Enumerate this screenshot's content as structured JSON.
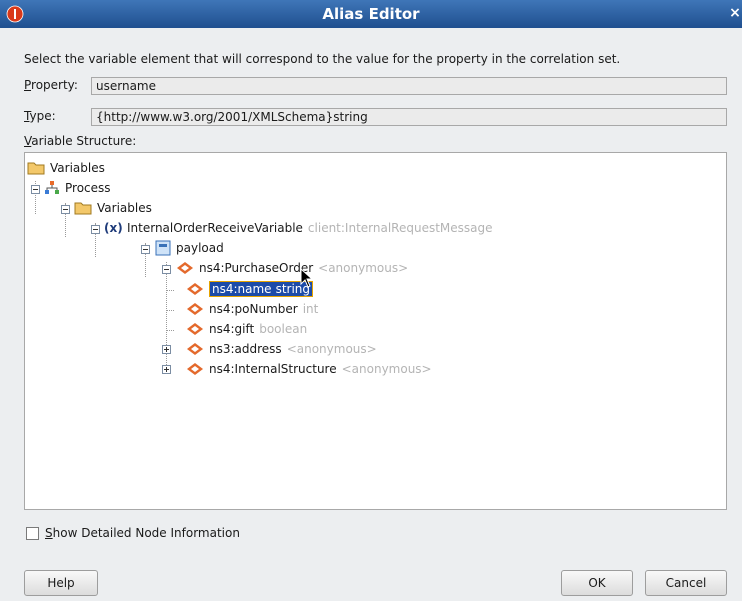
{
  "window": {
    "title": "Alias Editor",
    "close_glyph": "×"
  },
  "instruction": "Select the variable element that will correspond to the value for the property in the correlation set.",
  "property": {
    "label_underlined": "P",
    "label_rest": "roperty:",
    "value": "username"
  },
  "type_field": {
    "label_underlined": "T",
    "label_rest": "ype:",
    "value": "{http://www.w3.org/2001/XMLSchema}string"
  },
  "variable_structure": {
    "label_underlined": "V",
    "label_rest": "ariable Structure:"
  },
  "tree": {
    "variables_root": "Variables",
    "process": "Process",
    "process_variables": "Variables",
    "variable": {
      "name": "InternalOrderReceiveVariable",
      "type": "client:InternalRequestMessage"
    },
    "payload": "payload",
    "purchase_order": {
      "name": "ns4:PurchaseOrder",
      "type": "<anonymous>"
    },
    "children": [
      {
        "name": "ns4:name",
        "type": "string",
        "selected": true
      },
      {
        "name": "ns4:poNumber",
        "type": "int"
      },
      {
        "name": "ns4:gift",
        "type": "boolean"
      },
      {
        "name": "ns3:address",
        "type": "<anonymous>",
        "expandable": true
      },
      {
        "name": "ns4:InternalStructure",
        "type": "<anonymous>",
        "expandable": true
      }
    ]
  },
  "show_detailed": {
    "label_underlined": "S",
    "label_rest": "how Detailed Node Information",
    "checked": false
  },
  "buttons": {
    "help": "Help",
    "ok": "OK",
    "cancel": "Cancel"
  },
  "colors": {
    "title_bar": "#2d5fa3",
    "selection": "#1c4ba8",
    "type_text": "#b4b4b4"
  },
  "icons": {
    "app": "oracle-icon",
    "folder": "folder-icon",
    "process": "process-icon",
    "variable": "variable-icon",
    "message": "message-icon",
    "element": "element-icon"
  }
}
